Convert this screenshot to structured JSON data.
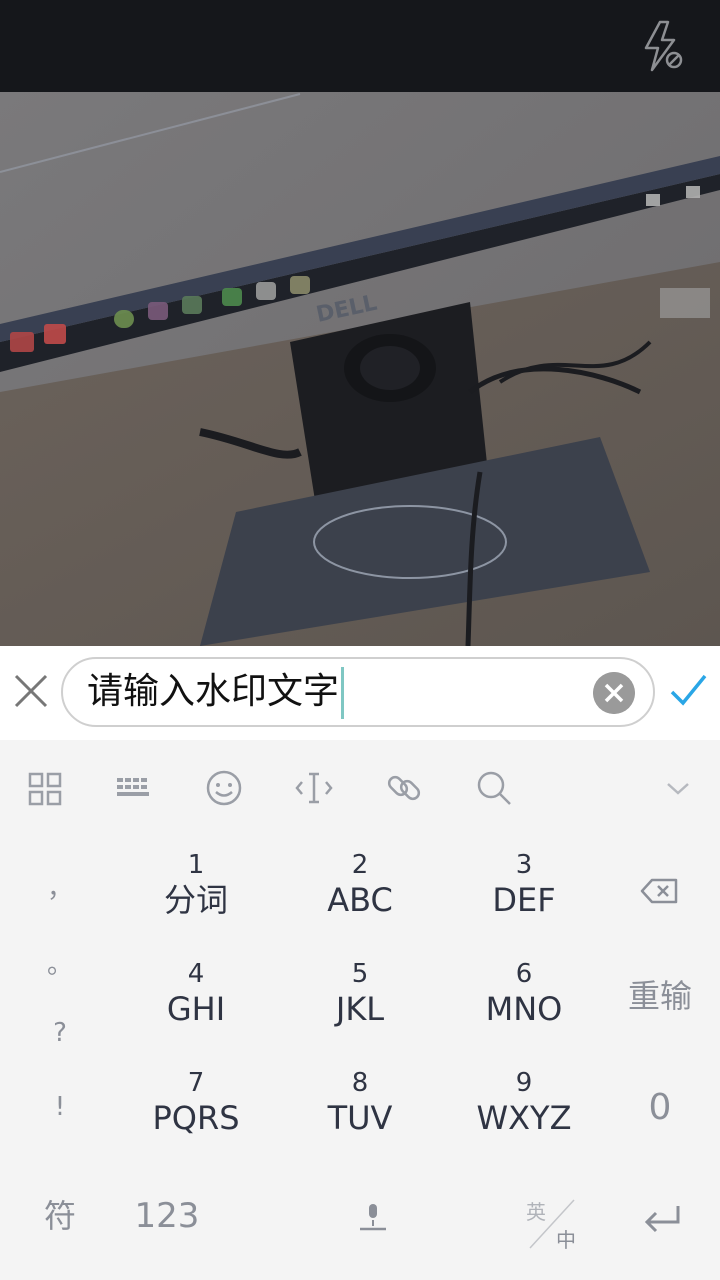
{
  "input": {
    "value": "请输入水印文字"
  },
  "keypad": {
    "punctuation": [
      "，",
      "。",
      "?",
      "!"
    ],
    "keys": [
      {
        "num": "1",
        "letters": "分词"
      },
      {
        "num": "2",
        "letters": "ABC"
      },
      {
        "num": "3",
        "letters": "DEF"
      },
      {
        "num": "4",
        "letters": "GHI"
      },
      {
        "num": "5",
        "letters": "JKL"
      },
      {
        "num": "6",
        "letters": "MNO"
      },
      {
        "num": "7",
        "letters": "PQRS"
      },
      {
        "num": "8",
        "letters": "TUV"
      },
      {
        "num": "9",
        "letters": "WXYZ"
      }
    ],
    "reinput": "重输",
    "zero": "0",
    "symbols": "符",
    "numbers": "123",
    "lang_en": "英",
    "lang_zh": "中"
  },
  "icons": {
    "top": [
      "flash-off-icon"
    ],
    "input": [
      "close-icon",
      "clear-icon",
      "check-icon"
    ],
    "toolbar": [
      "grid-icon",
      "keyboard-icon",
      "emoji-icon",
      "cursor-icon",
      "link-icon",
      "search-icon",
      "chevron-down-icon"
    ],
    "keyboard": [
      "backspace-icon",
      "microphone-icon",
      "enter-icon"
    ]
  },
  "colors": {
    "accent": "#2aa6e6",
    "topbar": "#15171b",
    "keyboard_bg": "#f4f4f4",
    "key_text": "#2f3443",
    "muted_text": "#8b8f98"
  }
}
